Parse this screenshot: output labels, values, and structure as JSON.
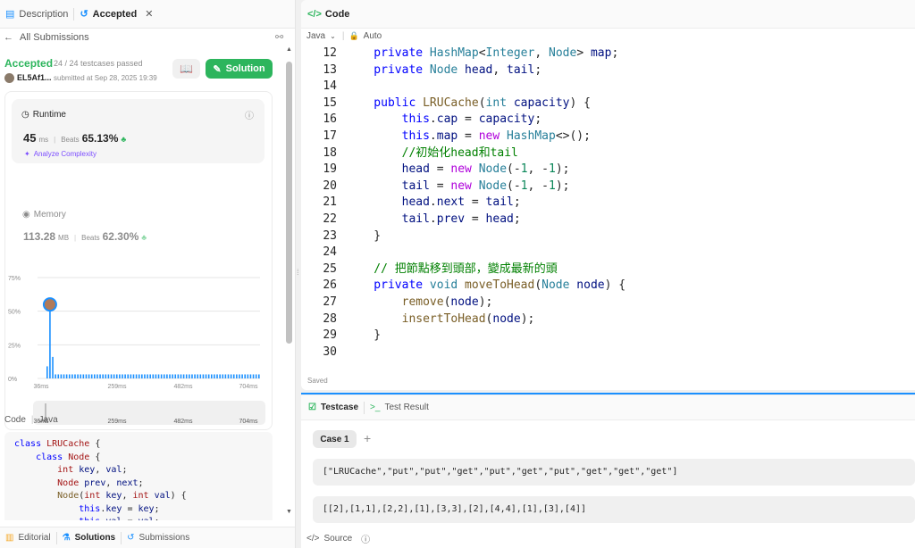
{
  "left_tabs": {
    "description": "Description",
    "accepted": "Accepted",
    "close": "✕"
  },
  "nav": {
    "back": "All Submissions"
  },
  "result": {
    "status": "Accepted",
    "passed": "24 / 24 testcases passed",
    "user": "EL5Af1...",
    "submitted": "submitted at Sep 28, 2025 19:39",
    "solution_btn": "Solution"
  },
  "runtime": {
    "label": "Runtime",
    "value": "45",
    "unit": "ms",
    "beats_label": "Beats",
    "beats": "65.13%",
    "analyze": "Analyze Complexity"
  },
  "memory": {
    "label": "Memory",
    "value": "113.28",
    "unit": "MB",
    "beats_label": "Beats",
    "beats": "62.30%"
  },
  "chart_data": {
    "type": "bar",
    "yticks": [
      "75%",
      "50%",
      "25%",
      "0%"
    ],
    "xticks": [
      "36ms",
      "259ms",
      "482ms",
      "704ms"
    ],
    "ylim": [
      0,
      75
    ],
    "highlight_x": 45,
    "highlight_y": 55,
    "bars": [
      9,
      55,
      16,
      3,
      3,
      3,
      3,
      3,
      3,
      3,
      3,
      3,
      3,
      3,
      3,
      3,
      3,
      3,
      3,
      3,
      3,
      3,
      3,
      3,
      3,
      3,
      3,
      3,
      3,
      3,
      3,
      3,
      3,
      3,
      3,
      3,
      3,
      3,
      3,
      3,
      3,
      3,
      3,
      3,
      3,
      3,
      3,
      3,
      3,
      3,
      3,
      3,
      3,
      3,
      3,
      3,
      3,
      3,
      3,
      3,
      3,
      3,
      3,
      3,
      3,
      3,
      3,
      3,
      3,
      3,
      3,
      3,
      3,
      3,
      3,
      3,
      3
    ],
    "range_ticks": [
      "36ms",
      "259ms",
      "482ms",
      "704ms"
    ]
  },
  "code_meta": {
    "label": "Code",
    "lang": "Java"
  },
  "code_preview": [
    [
      [
        "kw",
        "class "
      ],
      [
        "ty",
        "LRUCache"
      ],
      [
        "ph",
        " {"
      ]
    ],
    [
      [
        "kw",
        "    class "
      ],
      [
        "ty",
        "Node"
      ],
      [
        "ph",
        " {"
      ]
    ],
    [
      [
        "ty",
        "        int"
      ],
      [
        "vr",
        " key"
      ],
      [
        "ph",
        ", "
      ],
      [
        "vr",
        "val"
      ],
      [
        "ph",
        ";"
      ]
    ],
    [
      [
        "ty",
        "        Node"
      ],
      [
        "vr",
        " prev"
      ],
      [
        "ph",
        ", "
      ],
      [
        "vr",
        "next"
      ],
      [
        "ph",
        ";"
      ]
    ],
    [
      [
        "fn",
        "        Node"
      ],
      [
        "ph",
        "("
      ],
      [
        "ty",
        "int"
      ],
      [
        "vr",
        " key"
      ],
      [
        "ph",
        ", "
      ],
      [
        "ty",
        "int"
      ],
      [
        "vr",
        " val"
      ],
      [
        "ph",
        ") {"
      ]
    ],
    [
      [
        "kw",
        "            this"
      ],
      [
        "ph",
        "."
      ],
      [
        "vr",
        "key"
      ],
      [
        "ph",
        " = "
      ],
      [
        "vr",
        "key"
      ],
      [
        "ph",
        ";"
      ]
    ],
    [
      [
        "kw",
        "            this"
      ],
      [
        "ph",
        "."
      ],
      [
        "vr",
        "val"
      ],
      [
        "ph",
        " = "
      ],
      [
        "vr",
        "val"
      ],
      [
        "ph",
        ";"
      ]
    ]
  ],
  "bottom_tabs": {
    "editorial": "Editorial",
    "solutions": "Solutions",
    "submissions": "Submissions"
  },
  "editor": {
    "title": "Code",
    "lang": "Java",
    "auto": "Auto",
    "saved": "Saved",
    "line_numbers": [
      "12",
      "13",
      "14",
      "15",
      "16",
      "17",
      "18",
      "19",
      "20",
      "21",
      "22",
      "23",
      "24",
      "25",
      "26",
      "27",
      "28",
      "29",
      "30"
    ],
    "lines": [
      [
        [
          "kw",
          "    private "
        ],
        [
          "ty",
          "HashMap"
        ],
        [
          "ph",
          "<"
        ],
        [
          "ty",
          "Integer"
        ],
        [
          "ph",
          ", "
        ],
        [
          "ty",
          "Node"
        ],
        [
          "ph",
          "> "
        ],
        [
          "vr",
          "map"
        ],
        [
          "ph",
          ";"
        ]
      ],
      [
        [
          "kw",
          "    private "
        ],
        [
          "ty",
          "Node"
        ],
        [
          "vr",
          " head"
        ],
        [
          "ph",
          ", "
        ],
        [
          "vr",
          "tail"
        ],
        [
          "ph",
          ";"
        ]
      ],
      [],
      [
        [
          "kw",
          "    public "
        ],
        [
          "fn",
          "LRUCache"
        ],
        [
          "ph",
          "("
        ],
        [
          "ty",
          "int"
        ],
        [
          "vr",
          " capacity"
        ],
        [
          "ph",
          ") {"
        ]
      ],
      [
        [
          "kw",
          "        this"
        ],
        [
          "ph",
          "."
        ],
        [
          "vr",
          "cap"
        ],
        [
          "ph",
          " = "
        ],
        [
          "vr",
          "capacity"
        ],
        [
          "ph",
          ";"
        ]
      ],
      [
        [
          "kw",
          "        this"
        ],
        [
          "ph",
          "."
        ],
        [
          "vr",
          "map"
        ],
        [
          "ph",
          " = "
        ],
        [
          "kw2",
          "new "
        ],
        [
          "ty",
          "HashMap"
        ],
        [
          "ph",
          "<>();"
        ]
      ],
      [
        [
          "cm",
          "        //初始化head和tail"
        ]
      ],
      [
        [
          "vr",
          "        head"
        ],
        [
          "ph",
          " = "
        ],
        [
          "kw2",
          "new "
        ],
        [
          "ty",
          "Node"
        ],
        [
          "ph",
          "(-"
        ],
        [
          "num",
          "1"
        ],
        [
          "ph",
          ", -"
        ],
        [
          "num",
          "1"
        ],
        [
          "ph",
          ");"
        ]
      ],
      [
        [
          "vr",
          "        tail"
        ],
        [
          "ph",
          " = "
        ],
        [
          "kw2",
          "new "
        ],
        [
          "ty",
          "Node"
        ],
        [
          "ph",
          "(-"
        ],
        [
          "num",
          "1"
        ],
        [
          "ph",
          ", -"
        ],
        [
          "num",
          "1"
        ],
        [
          "ph",
          ");"
        ]
      ],
      [
        [
          "vr",
          "        head"
        ],
        [
          "ph",
          "."
        ],
        [
          "vr",
          "next"
        ],
        [
          "ph",
          " = "
        ],
        [
          "vr",
          "tail"
        ],
        [
          "ph",
          ";"
        ]
      ],
      [
        [
          "vr",
          "        tail"
        ],
        [
          "ph",
          "."
        ],
        [
          "vr",
          "prev"
        ],
        [
          "ph",
          " = "
        ],
        [
          "vr",
          "head"
        ],
        [
          "ph",
          ";"
        ]
      ],
      [
        [
          "ph",
          "    }"
        ]
      ],
      [],
      [
        [
          "cm",
          "    // 把節點移到頭部，變成最新的頭"
        ]
      ],
      [
        [
          "kw",
          "    private "
        ],
        [
          "ty",
          "void"
        ],
        [
          "fn",
          " moveToHead"
        ],
        [
          "ph",
          "("
        ],
        [
          "ty",
          "Node"
        ],
        [
          "vr",
          " node"
        ],
        [
          "ph",
          ") {"
        ]
      ],
      [
        [
          "fn",
          "        remove"
        ],
        [
          "ph",
          "("
        ],
        [
          "vr",
          "node"
        ],
        [
          "ph",
          ");"
        ]
      ],
      [
        [
          "fn",
          "        insertToHead"
        ],
        [
          "ph",
          "("
        ],
        [
          "vr",
          "node"
        ],
        [
          "ph",
          ");"
        ]
      ],
      [
        [
          "ph",
          "    }"
        ]
      ],
      []
    ]
  },
  "testcase": {
    "tab": "Testcase",
    "result_tab": "Test Result",
    "case": "Case 1",
    "add": "+",
    "input1": "[\"LRUCache\",\"put\",\"put\",\"get\",\"put\",\"get\",\"put\",\"get\",\"get\",\"get\"]",
    "input2": "[[2],[1,1],[2,2],[1],[3,3],[2],[4,4],[1],[3],[4]]",
    "source": "Source"
  },
  "colors": {
    "accepted": "#2db55d",
    "solution_btn": "#2db55d",
    "bar": "#1a90ff",
    "highlight": "#b07a5a"
  }
}
